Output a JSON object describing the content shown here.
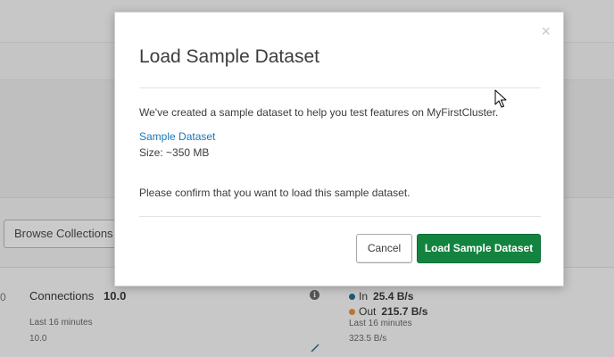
{
  "background": {
    "browse_collections_label": "Browse Collections",
    "connections": {
      "label": "Connections",
      "value": "10.0",
      "period": "Last 16 minutes",
      "axis_value": "10.0"
    },
    "network": {
      "in_label": "In",
      "in_value": "25.4 B/s",
      "out_label": "Out",
      "out_value": "215.7 B/s",
      "period": "Last 16 minutes",
      "axis_value": "323.5 B/s",
      "in_color": "#1a5f8a",
      "out_color": "#d7822e"
    },
    "left_edge_glyph": "0"
  },
  "modal": {
    "title": "Load Sample Dataset",
    "close_glyph": "×",
    "description": "We've created a sample dataset to help you test features on MyFirstCluster.",
    "dataset_link": "Sample Dataset",
    "size": "Size: ~350 MB",
    "confirm_text": "Please confirm that you want to load this sample dataset.",
    "cancel_label": "Cancel",
    "load_label": "Load Sample Dataset",
    "accent_color": "#13843f"
  }
}
